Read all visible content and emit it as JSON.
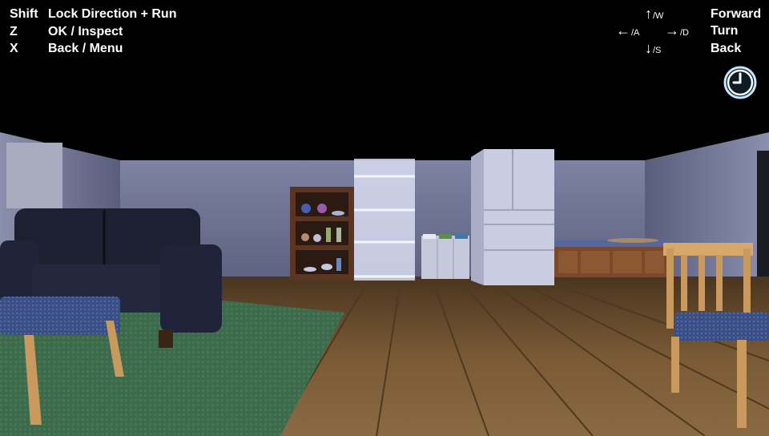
{
  "controls_left": [
    {
      "key": "Shift",
      "action": "Lock Direction + Run"
    },
    {
      "key": "Z",
      "action": "OK / Inspect"
    },
    {
      "key": "X",
      "action": "Back / Menu"
    }
  ],
  "controls_right": {
    "forward": {
      "arrow": "↑",
      "sub": "/W",
      "label": "Forward"
    },
    "left": {
      "arrow": "←",
      "sub": "/A"
    },
    "right": {
      "arrow": "→",
      "sub": "/D"
    },
    "turn_label": "Turn",
    "back": {
      "arrow": "↓",
      "sub": "/S",
      "label": "Back"
    }
  },
  "icons": {
    "clock": "clock-icon"
  },
  "colors": {
    "hud_text": "#ffffff",
    "clock_accent": "#bfe7ff",
    "floor": "#7a5a35",
    "rug": "#3f6b4c",
    "wall": "#6c7090"
  }
}
